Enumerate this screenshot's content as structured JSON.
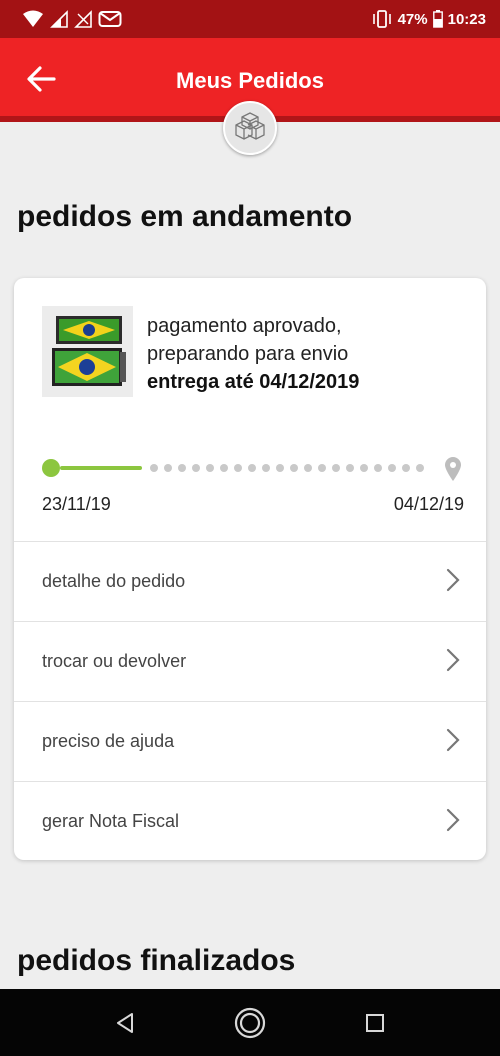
{
  "status_bar": {
    "battery": "47%",
    "time": "10:23"
  },
  "header": {
    "title": "Meus Pedidos"
  },
  "sections": {
    "in_progress_title": "pedidos em andamento",
    "finished_title": "pedidos finalizados"
  },
  "order": {
    "status_line1": "pagamento aprovado,",
    "status_line2": "preparando para envio",
    "delivery": "entrega até 04/12/2019",
    "start_date": "23/11/19",
    "end_date": "04/12/19",
    "progress": 0.25
  },
  "actions": [
    {
      "label": "detalhe do pedido"
    },
    {
      "label": "trocar ou devolver"
    },
    {
      "label": "preciso de ajuda"
    },
    {
      "label": "gerar Nota Fiscal"
    }
  ],
  "colors": {
    "status_bar": "#a31214",
    "app_bar": "#ee2325",
    "progress": "#8cc63f",
    "background": "#eeeeee"
  }
}
